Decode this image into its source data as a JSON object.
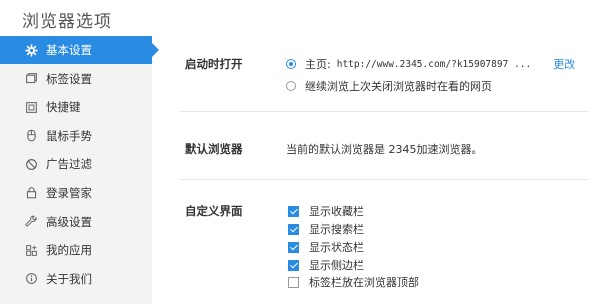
{
  "window": {
    "title": "浏览器选项"
  },
  "colors": {
    "accent": "#2a8be3",
    "sidebar_bg": "#f3f3f3"
  },
  "sidebar": {
    "items": [
      {
        "label": "基本设置",
        "icon": "gear-icon",
        "active": true
      },
      {
        "label": "标签设置",
        "icon": "tabs-icon"
      },
      {
        "label": "快捷键",
        "icon": "shortcut-icon"
      },
      {
        "label": "鼠标手势",
        "icon": "mouse-icon"
      },
      {
        "label": "广告过滤",
        "icon": "block-icon"
      },
      {
        "label": "登录管家",
        "icon": "lock-icon"
      },
      {
        "label": "高级设置",
        "icon": "wrench-icon"
      },
      {
        "label": "我的应用",
        "icon": "apps-icon"
      },
      {
        "label": "关于我们",
        "icon": "info-icon"
      }
    ]
  },
  "startup": {
    "title": "启动时打开",
    "homepage_label": "主页:",
    "homepage_url": "http://www.2345.com/?k15907897 ...",
    "change_label": "更改",
    "restore_label": "继续浏览上次关闭浏览器时在看的网页",
    "selected": "homepage"
  },
  "default_browser": {
    "title": "默认浏览器",
    "text": "当前的默认浏览器是 2345加速浏览器。"
  },
  "interface": {
    "title": "自定义界面",
    "options": [
      {
        "label": "显示收藏栏",
        "checked": true
      },
      {
        "label": "显示搜索栏",
        "checked": true
      },
      {
        "label": "显示状态栏",
        "checked": true
      },
      {
        "label": "显示侧边栏",
        "checked": true
      },
      {
        "label": "标签栏放在浏览器顶部",
        "checked": false
      }
    ]
  }
}
